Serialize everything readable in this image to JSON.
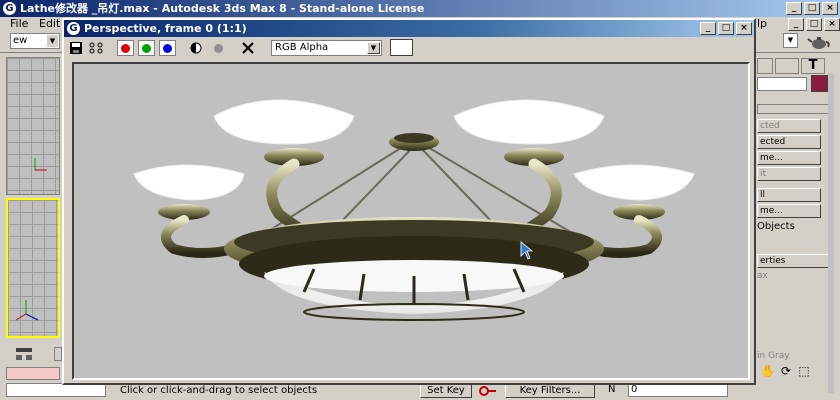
{
  "app": {
    "title": "Lathe修改器 _吊灯.max - Autodesk 3ds Max 8  - Stand-alone License",
    "logo_letter": "G",
    "menu": [
      "File",
      "Edit"
    ],
    "menu_right": "lp",
    "view_dropdown": "ew"
  },
  "render_window": {
    "title": "Perspective, frame 0 (1:1)",
    "logo_letter": "G",
    "channel_select": "RGB Alpha",
    "icons": [
      "save-icon",
      "clone-icon",
      "red-channel-icon",
      "green-channel-icon",
      "blue-channel-icon",
      "alpha-channel-icon",
      "mono-channel-icon",
      "clear-icon"
    ],
    "channel_colors": {
      "red": "#e00000",
      "green": "#00a000",
      "blue": "#0000e0"
    }
  },
  "command_panel": {
    "buttons": [
      "cted",
      "ected",
      "me...",
      "it",
      "ll",
      "me..."
    ],
    "objects_label": "Objects",
    "properties_label": "erties",
    "items_dim": [
      "ax",
      "in Gray"
    ],
    "swatch_color": "#8a1b3c"
  },
  "status": {
    "prompt": "Click or click-and-drag to select objects",
    "set_key": "Set Key",
    "key_filters": "Key Filters...",
    "frame_value": "0",
    "frame_label": "N"
  }
}
